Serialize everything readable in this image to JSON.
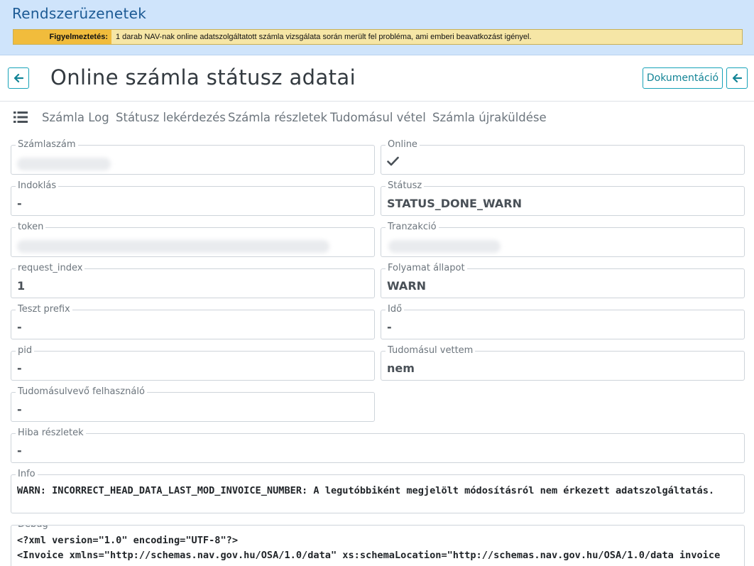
{
  "system_messages": {
    "title": "Rendszerüzenetek",
    "warning_label": "Figyelmeztetés:",
    "warning_text": "1 darab NAV-nak online adatszolgáltatott számla vizsgálata során merült fel probléma, ami emberi beavatkozást igényel."
  },
  "header": {
    "title": "Online számla státusz adatai",
    "doc_button": "Dokumentáció"
  },
  "nav": {
    "tabs": [
      "Számla Log",
      "Státusz lekérdezés",
      "Számla részletek",
      "Tudomásul vétel",
      "Számla újraküldése"
    ]
  },
  "fields": {
    "szamlaszam": {
      "label": "Számlaszám",
      "value": ""
    },
    "online": {
      "label": "Online",
      "value": "true"
    },
    "indoklas": {
      "label": "Indoklás",
      "value": "-"
    },
    "statusz": {
      "label": "Státusz",
      "value": "STATUS_DONE_WARN"
    },
    "token": {
      "label": "token",
      "value": ""
    },
    "tranzakcio": {
      "label": "Tranzakció",
      "value": ""
    },
    "request_index": {
      "label": "request_index",
      "value": "1"
    },
    "folyamat_allapot": {
      "label": "Folyamat állapot",
      "value": "WARN"
    },
    "teszt_prefix": {
      "label": "Teszt prefix",
      "value": "-"
    },
    "ido": {
      "label": "Idő",
      "value": "-"
    },
    "pid": {
      "label": "pid",
      "value": "-"
    },
    "tudomasul_vettem": {
      "label": "Tudomásul vettem",
      "value": "nem"
    },
    "tudomasulvevo": {
      "label": "Tudomásulvevő felhasználó",
      "value": "-"
    },
    "hiba_reszletek": {
      "label": "Hiba részletek",
      "value": "-"
    },
    "info": {
      "label": "Info",
      "value": "WARN: INCORRECT_HEAD_DATA_LAST_MOD_INVOICE_NUMBER: A legutóbbiként megjelölt módosításról nem érkezett adatszolgáltatás."
    },
    "debug": {
      "label": "Debug",
      "line1": "<?xml version=\"1.0\" encoding=\"UTF-8\"?>",
      "line2": "<Invoice xmlns=\"http://schemas.nav.gov.hu/OSA/1.0/data\" xs:schemaLocation=\"http://schemas.nav.gov.hu/OSA/1.0/data invoice"
    }
  },
  "icons": {
    "back": "arrow-left-icon",
    "menu": "list-icon",
    "online": "check-icon"
  },
  "colors": {
    "banner_bg": "#cfe4fb",
    "banner_title": "#1c5a94",
    "warning_label_bg": "#f1bc3c",
    "warning_bg": "#f6e6a6",
    "accent": "#17a2b8"
  }
}
